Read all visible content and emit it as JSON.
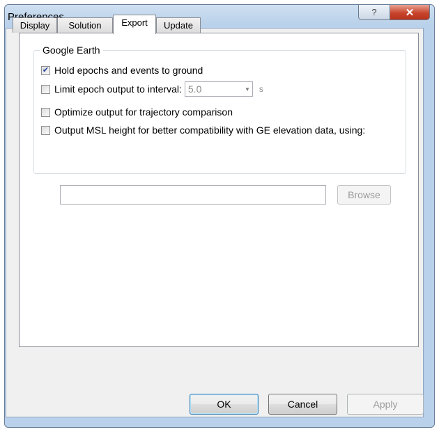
{
  "window": {
    "title": "Preferences",
    "help_glyph": "?",
    "close_glyph": "✕"
  },
  "tabs": [
    {
      "label": "Display",
      "active": false
    },
    {
      "label": "Solution",
      "active": false
    },
    {
      "label": "Export",
      "active": true
    },
    {
      "label": "Update",
      "active": false
    }
  ],
  "google_earth": {
    "title": "Google Earth",
    "hold_epochs": {
      "label": "Hold epochs and events to ground",
      "checked": true
    },
    "limit_epoch": {
      "label": "Limit epoch output to interval:",
      "checked": false,
      "value": "5.0",
      "unit": "s"
    },
    "optimize": {
      "label": "Optimize output for trajectory comparison",
      "checked": false
    },
    "msl": {
      "label": "Output MSL height for better compatibility with GE elevation data, using:",
      "checked": false,
      "path_value": ""
    },
    "browse_label": "Browse"
  },
  "buttons": {
    "ok": "OK",
    "cancel": "Cancel",
    "apply": "Apply"
  }
}
